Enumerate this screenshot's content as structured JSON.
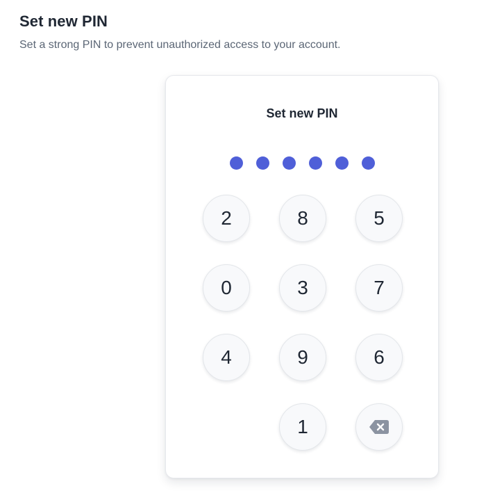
{
  "page": {
    "title": "Set new PIN",
    "subtitle": "Set a strong PIN to prevent unauthorized access to your account."
  },
  "card": {
    "title": "Set new PIN",
    "pin_length": 6,
    "filled_count": 6,
    "dot_color": "#4f5fd8"
  },
  "keypad": {
    "row1": [
      "2",
      "8",
      "5"
    ],
    "row2": [
      "0",
      "3",
      "7"
    ],
    "row3": [
      "4",
      "9",
      "6"
    ],
    "row4": [
      "",
      "1",
      "backspace"
    ],
    "backspace_icon": "backspace-icon",
    "backspace_color": "#8b93a1"
  }
}
